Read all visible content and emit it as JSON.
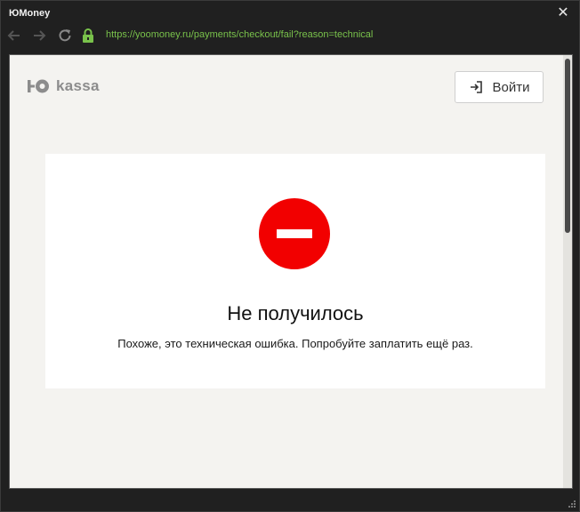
{
  "window": {
    "title": "ЮMoney",
    "close_glyph": "✕"
  },
  "navbar": {
    "url": "https://yoomoney.ru/payments/checkout/fail?reason=technical",
    "url_color": "#79c24b",
    "icons": [
      "back-arrow-icon",
      "forward-arrow-icon",
      "reload-icon",
      "lock-icon"
    ]
  },
  "page": {
    "logo": {
      "mark": "ЮО",
      "word": "kassa"
    },
    "login_button": {
      "label": "Войти",
      "icon": "login-icon"
    },
    "error": {
      "icon": "no-entry-icon",
      "icon_color": "#f20000",
      "title": "Не получилось",
      "message": "Похоже, это техническая ошибка. Попробуйте заплатить ещё раз."
    }
  }
}
